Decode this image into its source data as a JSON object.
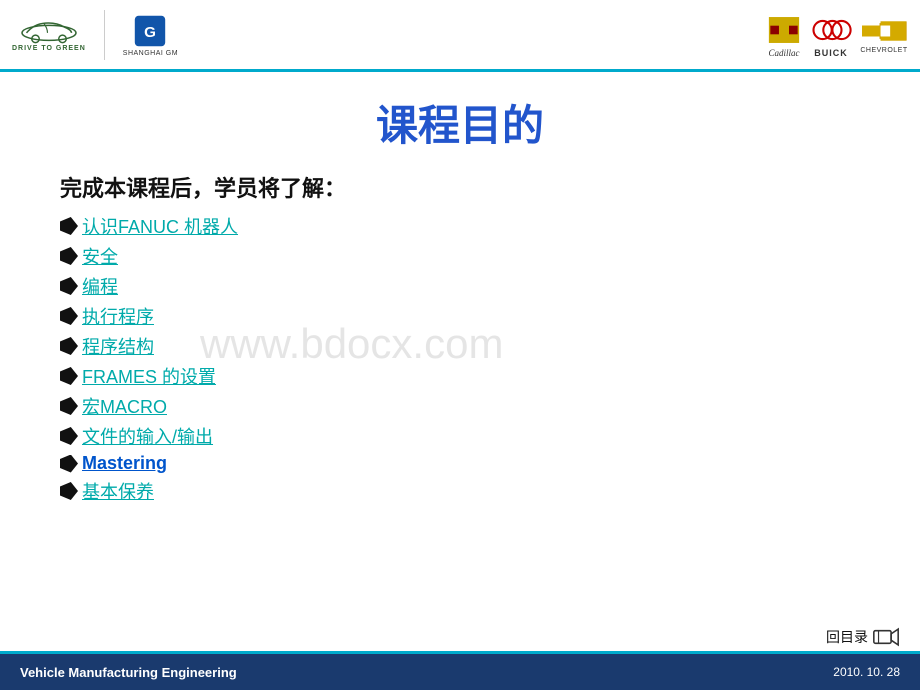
{
  "header": {
    "left": {
      "logo1_alt": "Drive to Green",
      "logo1_sub": "DRIVE TO GREEN",
      "logo2_alt": "Shanghai GM",
      "logo2_sub": "SHANGHAI GM"
    },
    "right": {
      "brand1": "Cadillac",
      "brand2": "BUICK",
      "brand3": "CHEVROLET"
    }
  },
  "page": {
    "title": "课程目的",
    "subtitle": "完成本课程后，学员将了解：",
    "items": [
      {
        "label": "认识FANUC 机器人",
        "type": "link"
      },
      {
        "label": "安全",
        "type": "link"
      },
      {
        "label": "编程",
        "type": "link"
      },
      {
        "label": "执行程序",
        "type": "link"
      },
      {
        "label": "程序结构",
        "type": "link"
      },
      {
        "label": "FRAMES 的设置",
        "type": "link"
      },
      {
        "label": "宏MACRO",
        "type": "link"
      },
      {
        "label": "文件的输入/输出",
        "type": "link"
      },
      {
        "label": "Mastering",
        "type": "mastering"
      },
      {
        "label": "基本保养",
        "type": "link"
      }
    ],
    "watermark": "www.bdocx.com",
    "back_nav_label": "回目录",
    "footer_title": "Vehicle Manufacturing Engineering",
    "footer_date": "2010. 10. 28"
  }
}
